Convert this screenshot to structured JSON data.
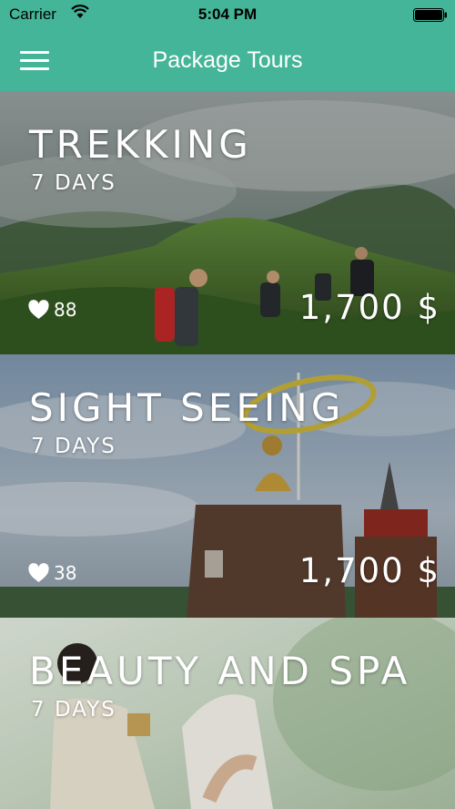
{
  "status_bar": {
    "carrier": "Carrier",
    "time": "5:04 PM"
  },
  "nav": {
    "title": "Package Tours",
    "menu_icon": "hamburger-menu-icon"
  },
  "colors": {
    "accent": "#44b598",
    "text": "#ffffff"
  },
  "tours": [
    {
      "name": "TREKKING",
      "duration": "7 DAYS",
      "likes": "88",
      "price": "1,700 $"
    },
    {
      "name": "SIGHT SEEING",
      "duration": "7 DAYS",
      "likes": "38",
      "price": "1,700 $"
    },
    {
      "name": "BEAUTY AND SPA",
      "duration": "7 DAYS"
    }
  ]
}
